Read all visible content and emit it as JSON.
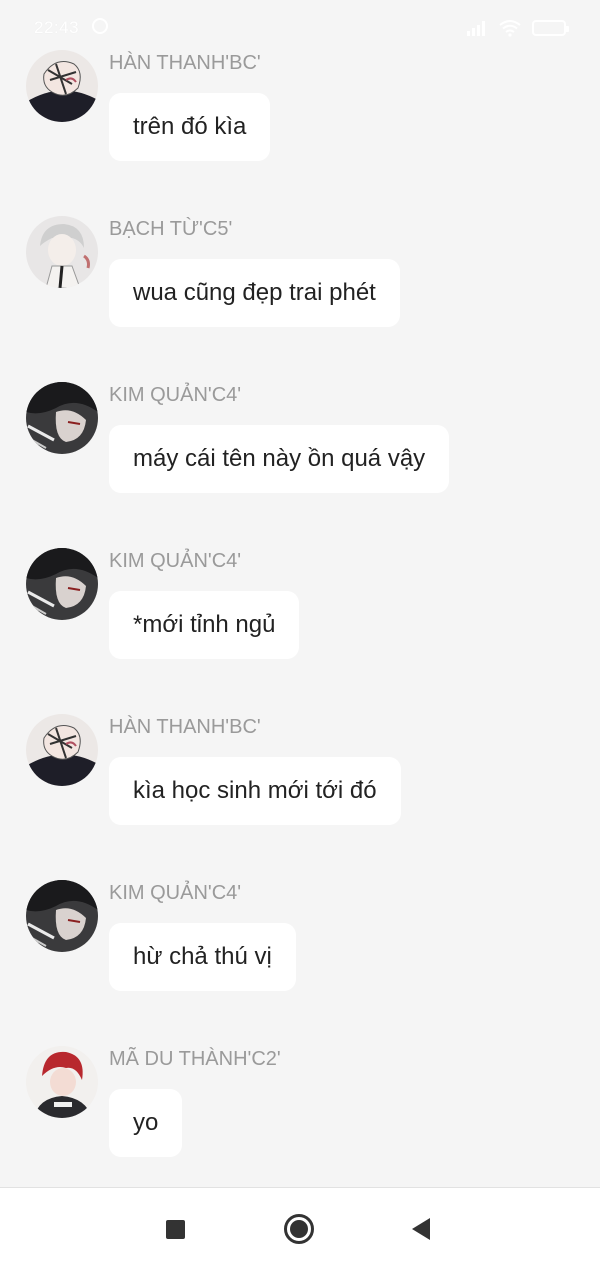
{
  "status_bar": {
    "time": "22:43"
  },
  "messages": [
    {
      "sender": "HÀN THANH'BC'",
      "text": "trên đó kìa",
      "avatar": "avatar-han-thanh"
    },
    {
      "sender": "BẠCH TỪ'C5'",
      "text": "wua cũng đẹp trai phét",
      "avatar": "avatar-bach-tu"
    },
    {
      "sender": "KIM QUẢN'C4'",
      "text": "máy cái tên này ồn quá vậy",
      "avatar": "avatar-kim-quan"
    },
    {
      "sender": "KIM QUẢN'C4'",
      "text": "*mới tỉnh ngủ",
      "avatar": "avatar-kim-quan"
    },
    {
      "sender": "HÀN THANH'BC'",
      "text": "kìa học sinh mới tới đó",
      "avatar": "avatar-han-thanh"
    },
    {
      "sender": "KIM QUẢN'C4'",
      "text": "hừ chả thú vị",
      "avatar": "avatar-kim-quan"
    },
    {
      "sender": "MÃ DU THÀNH'C2'",
      "text": "yo",
      "avatar": "avatar-ma-du-thanh"
    }
  ],
  "nav_bar": {
    "recents_icon": "square-icon",
    "home_icon": "circle-home-icon",
    "back_icon": "triangle-back-icon"
  },
  "colors": {
    "background": "#f5f5f5",
    "bubble": "#ffffff",
    "sender_name": "#9a9a9a",
    "message_text": "#222222"
  }
}
